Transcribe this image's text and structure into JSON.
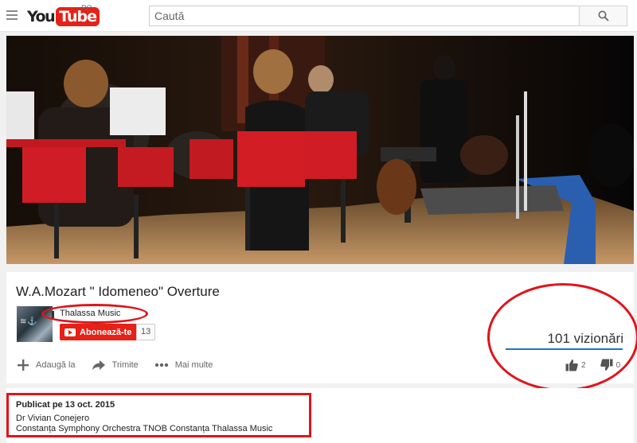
{
  "header": {
    "logo_you": "You",
    "logo_tube": "Tube",
    "region": "RO",
    "search_placeholder": "Caută"
  },
  "video": {
    "title": "W.A.Mozart \" Idomeneo\" Overture",
    "channel": "Thalassa Music",
    "subscribe_label": "Abonează-te",
    "subscriber_count": "13",
    "views": "101 vizionări",
    "likes": "2",
    "dislikes": "0"
  },
  "actions": {
    "add_to": "Adaugă la",
    "share": "Trimite",
    "more": "Mai multe"
  },
  "description": {
    "published": "Publicat pe 13 oct. 2015",
    "line1": "Dr Vivian Conejero",
    "line2": "Constanța Symphony Orchestra TNOB Constanța Thalassa Music"
  },
  "colors": {
    "brand_red": "#e62117",
    "annotation_red": "#e0141b",
    "view_bar_blue": "#167ac6"
  },
  "icons": [
    "menu-icon",
    "search-icon",
    "plus-icon",
    "share-icon",
    "more-icon",
    "thumbs-up-icon",
    "thumbs-down-icon"
  ]
}
